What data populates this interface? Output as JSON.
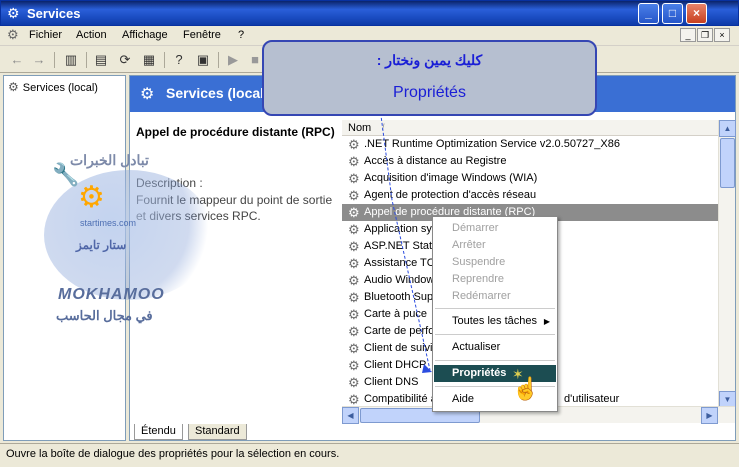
{
  "window": {
    "title": "Services",
    "buttons": {
      "minimize": "_",
      "maximize": "□",
      "close": "×"
    }
  },
  "menu": {
    "items": [
      "Fichier",
      "Action",
      "Affichage",
      "Fenêtre",
      "?"
    ],
    "mdi": {
      "minimize": "_",
      "restore": "❐",
      "close": "×"
    }
  },
  "tree": {
    "root": "Services (local)"
  },
  "pane": {
    "header": "Services (local)",
    "selected_title": "Appel de procédure distante (RPC)",
    "description_label": "Description :",
    "description_text": "Fournit le mappeur du point de sortie et divers services RPC."
  },
  "list": {
    "column": "Nom",
    "sort_marker": "/",
    "rows": [
      ".NET Runtime Optimization Service v2.0.50727_X86",
      "Accès à distance au Registre",
      "Acquisition d'image Windows (WIA)",
      "Agent de protection d'accès réseau",
      "Appel de procédure distante (RPC)",
      "Application sy",
      "ASP.NET State",
      "Assistance TC",
      "Audio Window",
      "Bluetooth Sup",
      "Carte à puce",
      "Carte de perfo",
      "Client de suivi",
      "Client DHCP",
      "Client DNS",
      "Compatibilité à"
    ],
    "selected_index": 4,
    "extra_text": "d'utilisateur"
  },
  "context_menu": {
    "items": [
      {
        "label": "Démarrer",
        "enabled": false
      },
      {
        "label": "Arrêter",
        "enabled": false
      },
      {
        "label": "Suspendre",
        "enabled": false
      },
      {
        "label": "Reprendre",
        "enabled": false
      },
      {
        "label": "Redémarrer",
        "enabled": false
      },
      {
        "label": "Toutes les tâches",
        "enabled": true,
        "submenu": "▶"
      },
      {
        "label": "Actualiser",
        "enabled": true
      },
      {
        "label": "Propriétés",
        "enabled": true,
        "highlighted": true
      },
      {
        "label": "Aide",
        "enabled": true
      }
    ]
  },
  "tabs": {
    "extended": "Étendu",
    "standard": "Standard"
  },
  "status": "Ouvre la boîte de dialogue des propriétés pour la sélection en cours.",
  "callout": {
    "arabic": "كليك يمين ونختار :",
    "french": "Propriétés"
  },
  "watermark": {
    "line1": "تبادل الخبرات",
    "site": "startimes.com",
    "line2": "ستار تايمز",
    "brand": "MOKHAMOO",
    "line3": "في مجال الحاسب"
  },
  "colors": {
    "titlebar": "#2a5fd9",
    "header": "#3a6fd4",
    "selection": "#8c8c8c",
    "highlight": "#1c4d52",
    "callout_text": "#1a1ed6"
  }
}
